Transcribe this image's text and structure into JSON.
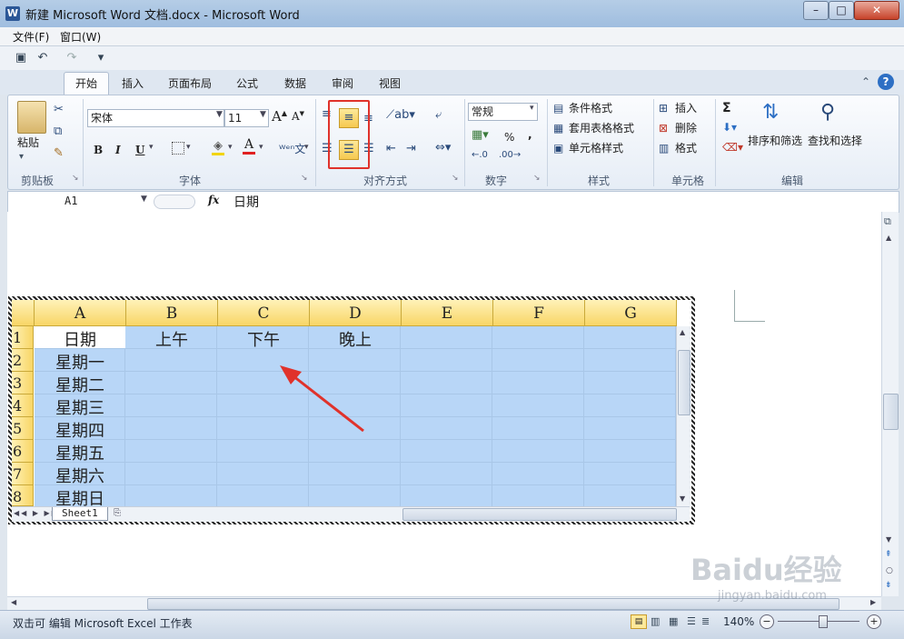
{
  "window": {
    "title": "新建 Microsoft Word 文档.docx - Microsoft Word",
    "app_icon": "W",
    "minimize": "–",
    "maximize": "□",
    "close": "✕"
  },
  "menubar": {
    "items": [
      "文件(F)",
      "窗口(W)"
    ]
  },
  "ribbon_tabs": [
    "开始",
    "插入",
    "页面布局",
    "公式",
    "数据",
    "审阅",
    "视图"
  ],
  "ribbon": {
    "clipboard": {
      "paste_label": "粘贴",
      "group_label": "剪贴板"
    },
    "font": {
      "font_name": "宋体",
      "font_size": "11",
      "bold": "B",
      "italic": "I",
      "underline": "U",
      "group_label": "字体"
    },
    "alignment": {
      "group_label": "对齐方式"
    },
    "number": {
      "format": "常规",
      "percent": "%",
      "comma": ",",
      "group_label": "数字"
    },
    "styles": {
      "conditional": "条件格式",
      "table_style": "套用表格格式",
      "cell_style": "单元格样式",
      "group_label": "样式"
    },
    "cells": {
      "insert": "插入",
      "delete": "删除",
      "format": "格式",
      "group_label": "单元格"
    },
    "editing": {
      "sigma": "Σ",
      "sort_filter": "排序和筛选",
      "find_select": "查找和选择",
      "group_label": "编辑"
    }
  },
  "formula_bar": {
    "name_box": "A1",
    "fx": "fx",
    "content": "日期"
  },
  "sheet": {
    "columns": [
      "A",
      "B",
      "C",
      "D",
      "E",
      "F",
      "G"
    ],
    "rows": [
      "1",
      "2",
      "3",
      "4",
      "5",
      "6",
      "7",
      "8"
    ],
    "header_row": [
      "日期",
      "上午",
      "下午",
      "晚上"
    ],
    "days": [
      "星期一",
      "星期二",
      "星期三",
      "星期四",
      "星期五",
      "星期六",
      "星期日"
    ],
    "tab_name": "Sheet1"
  },
  "status_bar": {
    "left_text": "双击可 编辑 Microsoft Excel 工作表",
    "zoom": "140%"
  },
  "watermark": {
    "text": "Baidu经验",
    "url": "jingyan.baidu.com"
  },
  "colors": {
    "selection": "#b8d6f7",
    "header_fill": "#f8d666",
    "arrow": "#e0322b",
    "highlight_box": "#e0322b"
  }
}
